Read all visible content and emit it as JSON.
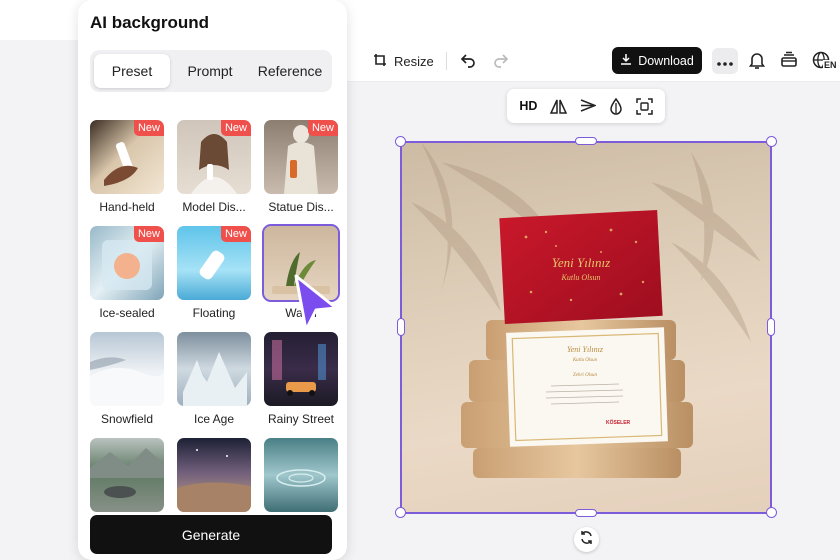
{
  "panel": {
    "title": "AI background",
    "tabs": [
      {
        "label": "Preset",
        "active": true
      },
      {
        "label": "Prompt",
        "active": false
      },
      {
        "label": "Reference",
        "active": false
      }
    ],
    "presets": [
      {
        "label": "Hand-held",
        "badge": "New"
      },
      {
        "label": "Model Dis...",
        "badge": "New"
      },
      {
        "label": "Statue Dis...",
        "badge": "New"
      },
      {
        "label": "Ice-sealed",
        "badge": "New"
      },
      {
        "label": "Floating",
        "badge": "New"
      },
      {
        "label": "Warm",
        "badge": "",
        "selected": true
      },
      {
        "label": "Snowfield",
        "badge": ""
      },
      {
        "label": "Ice Age",
        "badge": ""
      },
      {
        "label": "Rainy Street",
        "badge": ""
      },
      {
        "label": "",
        "badge": ""
      },
      {
        "label": "",
        "badge": ""
      },
      {
        "label": "",
        "badge": ""
      }
    ],
    "generate_label": "Generate"
  },
  "toolbar": {
    "resize_label": "Resize",
    "download_label": "Download",
    "lang_code": "EN"
  },
  "float_toolbar": {
    "hd_label": "HD"
  },
  "card": {
    "front_title": "Yeni Yılınız",
    "front_subtitle": "Kutlu Olsun",
    "back_title": "Yeni Yılınız",
    "back_subtitle": "Kutlu Olsun",
    "back_name": "Zehri Olsun",
    "back_brand": "KÖSELER"
  },
  "colors": {
    "accent": "#7c5cdb",
    "badge": "#f0504b",
    "dark": "#111111"
  }
}
